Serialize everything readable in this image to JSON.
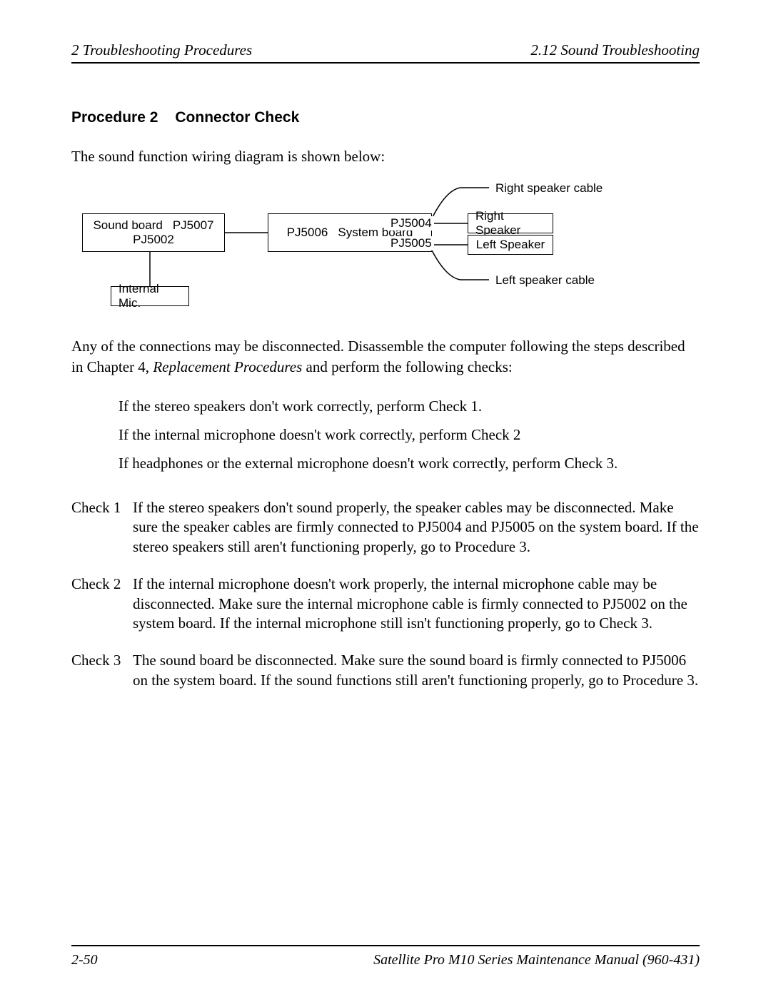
{
  "header": {
    "left": "2  Troubleshooting Procedures",
    "right": "2.12  Sound Troubleshooting"
  },
  "procedure": {
    "number": "Procedure 2",
    "title": "Connector Check"
  },
  "intro": "The sound function wiring diagram is shown below:",
  "diagram": {
    "sound_board": "Sound board",
    "pj5007": "PJ5007",
    "pj5002": "PJ5002",
    "pj5006": "PJ5006",
    "system_board": "System board",
    "pj5004": "PJ5004",
    "pj5005": "PJ5005",
    "internal_mic": "Internal Mic.",
    "right_speaker": "Right Speaker",
    "left_speaker": "Left Speaker",
    "right_cable": "Right speaker cable",
    "left_cable": "Left speaker cable"
  },
  "para2a": "Any of the connections may be disconnected. Disassemble the computer following the steps described in Chapter 4, ",
  "para2b": "Replacement Procedures",
  "para2c": " and perform the following checks:",
  "bullets": [
    "If the stereo speakers don't work correctly, perform Check 1.",
    "If the internal microphone doesn't work correctly, perform Check 2",
    "If headphones or the external microphone doesn't work correctly, perform Check 3."
  ],
  "checks": [
    {
      "label": "Check 1",
      "text": "If the stereo speakers don't sound properly, the speaker cables may be disconnected. Make sure the speaker cables are firmly connected to PJ5004 and PJ5005 on the system board. If the stereo speakers still aren't functioning properly, go to Procedure 3."
    },
    {
      "label": "Check 2",
      "text": "If the internal microphone doesn't work properly, the internal microphone cable may be disconnected. Make sure the internal microphone cable is firmly connected to PJ5002 on the system board. If the internal microphone still isn't functioning properly, go to Check 3."
    },
    {
      "label": "Check 3",
      "text": "The sound board be disconnected. Make sure the sound board is firmly connected to PJ5006 on the system board. If the sound functions still aren't functioning properly, go to Procedure 3."
    }
  ],
  "footer": {
    "left": "2-50",
    "right": "Satellite Pro M10 Series Maintenance Manual (960-431)"
  }
}
